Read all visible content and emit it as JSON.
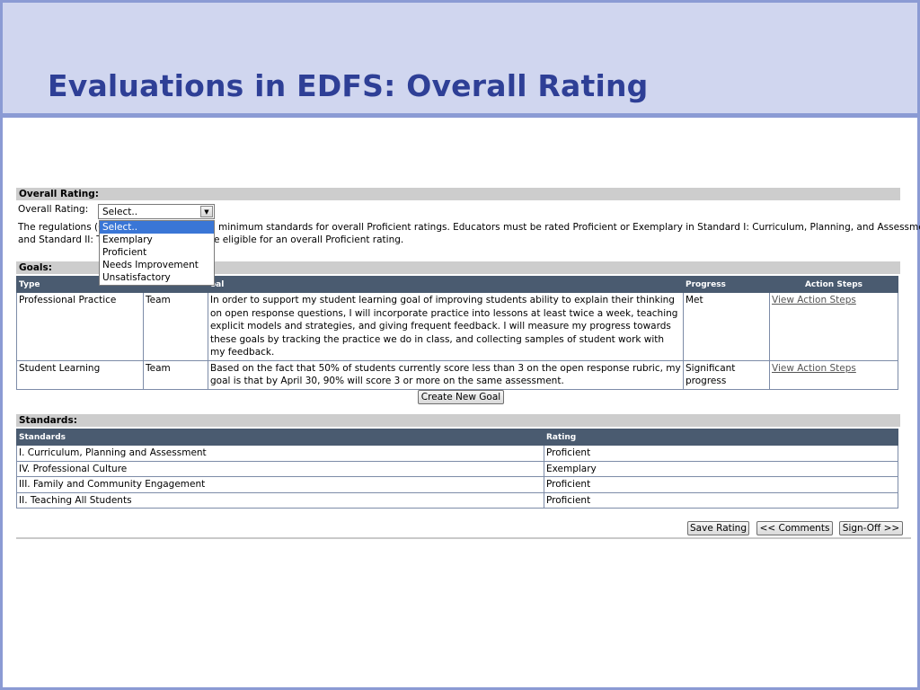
{
  "slide": {
    "title": "Evaluations in EDFS: Overall Rating"
  },
  "overall_rating": {
    "section_title": "Overall Rating:",
    "field_label": "Overall Rating:",
    "selected": "Select..",
    "options": [
      "Select..",
      "Exemplary",
      "Proficient",
      "Needs Improvement",
      "Unsatisfactory"
    ],
    "description_line1_left": "The regulations (6",
    "description_line1_right": "minimum standards for overall Proficient ratings. Educators must be rated Proficient or Exemplary in Standard I: Curriculum, Planning, and Assessment",
    "description_line2_left": "and Standard II: T",
    "description_line2_right": "e eligible for an overall Proficient rating."
  },
  "goals": {
    "section_title": "Goals:",
    "headers": {
      "type": "Type",
      "owner": "",
      "goal": "oal",
      "progress": "Progress",
      "action": "Action Steps"
    },
    "rows": [
      {
        "type": "Professional Practice",
        "owner": "Team",
        "goal": "In order to support my student learning goal of improving students ability to explain their thinking on open response questions, I will incorporate practice into lessons at least twice a week, teaching explicit models and strategies, and giving frequent feedback. I will measure my progress towards these goals by tracking the practice we do in class, and collecting samples of student work with my feedback.",
        "progress": "Met",
        "action": "View Action Steps"
      },
      {
        "type": "Student Learning",
        "owner": "Team",
        "goal": "Based on the fact that 50% of students currently score less than 3 on the open response rubric, my goal is that by April 30, 90% will score 3 or more on the same assessment.",
        "progress": "Significant progress",
        "action": "View Action Steps"
      }
    ],
    "create_button": "Create New Goal"
  },
  "standards": {
    "section_title": "Standards:",
    "headers": {
      "standard": "Standards",
      "rating": "Rating"
    },
    "rows": [
      {
        "standard": "I. Curriculum, Planning and Assessment",
        "rating": "Proficient"
      },
      {
        "standard": "IV. Professional Culture",
        "rating": "Exemplary"
      },
      {
        "standard": "III. Family and Community Engagement",
        "rating": "Proficient"
      },
      {
        "standard": "II. Teaching All Students",
        "rating": "Proficient"
      }
    ]
  },
  "footer": {
    "save_button": "Save Rating",
    "comments_button": "<< Comments",
    "signoff_button": "Sign-Off >>"
  }
}
